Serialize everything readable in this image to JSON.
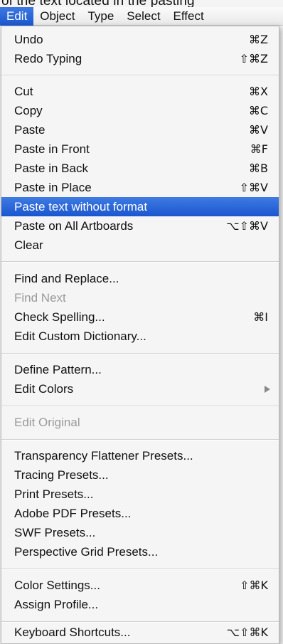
{
  "caption": "of the text located in the pasting",
  "menubar": {
    "items": [
      "Edit",
      "Object",
      "Type",
      "Select",
      "Effect"
    ]
  },
  "menu": {
    "items": [
      {
        "label": "Undo",
        "shortcut": "⌘Z"
      },
      {
        "label": "Redo Typing",
        "shortcut": "⇧⌘Z"
      },
      {
        "label": "Cut",
        "shortcut": "⌘X"
      },
      {
        "label": "Copy",
        "shortcut": "⌘C"
      },
      {
        "label": "Paste",
        "shortcut": "⌘V"
      },
      {
        "label": "Paste in Front",
        "shortcut": "⌘F"
      },
      {
        "label": "Paste in Back",
        "shortcut": "⌘B"
      },
      {
        "label": "Paste in Place",
        "shortcut": "⇧⌘V"
      },
      {
        "label": "Paste text without format",
        "shortcut": ""
      },
      {
        "label": "Paste on All Artboards",
        "shortcut": "⌥⇧⌘V"
      },
      {
        "label": "Clear",
        "shortcut": ""
      },
      {
        "label": "Find and Replace...",
        "shortcut": ""
      },
      {
        "label": "Find Next",
        "shortcut": ""
      },
      {
        "label": "Check Spelling...",
        "shortcut": "⌘I"
      },
      {
        "label": "Edit Custom Dictionary...",
        "shortcut": ""
      },
      {
        "label": "Define Pattern...",
        "shortcut": ""
      },
      {
        "label": "Edit Colors",
        "shortcut": ""
      },
      {
        "label": "Edit Original",
        "shortcut": ""
      },
      {
        "label": "Transparency Flattener Presets...",
        "shortcut": ""
      },
      {
        "label": "Tracing Presets...",
        "shortcut": ""
      },
      {
        "label": "Print Presets...",
        "shortcut": ""
      },
      {
        "label": "Adobe PDF Presets...",
        "shortcut": ""
      },
      {
        "label": "SWF Presets...",
        "shortcut": ""
      },
      {
        "label": "Perspective Grid Presets...",
        "shortcut": ""
      },
      {
        "label": "Color Settings...",
        "shortcut": "⇧⌘K"
      },
      {
        "label": "Assign Profile...",
        "shortcut": ""
      },
      {
        "label": "Keyboard Shortcuts...",
        "shortcut": "⌥⇧⌘K"
      }
    ]
  }
}
